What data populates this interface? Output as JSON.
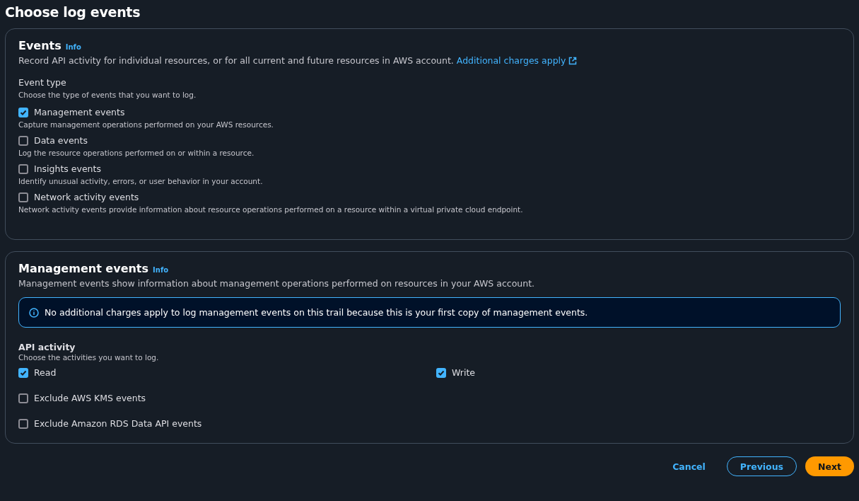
{
  "page_title": "Choose log events",
  "events": {
    "title": "Events",
    "info": "Info",
    "description": "Record API activity for individual resources, or for all current and future resources in AWS account.",
    "link": "Additional charges apply",
    "event_type": {
      "label": "Event type",
      "description": "Choose the type of events that you want to log.",
      "options": [
        {
          "label": "Management events",
          "description": "Capture management operations performed on your AWS resources.",
          "checked": true
        },
        {
          "label": "Data events",
          "description": "Log the resource operations performed on or within a resource.",
          "checked": false
        },
        {
          "label": "Insights events",
          "description": "Identify unusual activity, errors, or user behavior in your account.",
          "checked": false
        },
        {
          "label": "Network activity events",
          "description": "Network activity events provide information about resource operations performed on a resource within a virtual private cloud endpoint.",
          "checked": false
        }
      ]
    }
  },
  "management_events": {
    "title": "Management events",
    "info": "Info",
    "description": "Management events show information about management operations performed on resources in your AWS account.",
    "alert": "No additional charges apply to log management events on this trail because this is your first copy of management events.",
    "api_activity": {
      "label": "API activity",
      "description": "Choose the activities you want to log.",
      "activities": [
        {
          "label": "Read",
          "checked": true
        },
        {
          "label": "Write",
          "checked": true
        }
      ],
      "exclusions": [
        {
          "label": "Exclude AWS KMS events",
          "checked": false
        },
        {
          "label": "Exclude Amazon RDS Data API events",
          "checked": false
        }
      ]
    }
  },
  "buttons": [
    {
      "label": "Cancel",
      "kind": "link"
    },
    {
      "label": "Previous",
      "kind": "secondary"
    },
    {
      "label": "Next",
      "kind": "primary"
    }
  ]
}
